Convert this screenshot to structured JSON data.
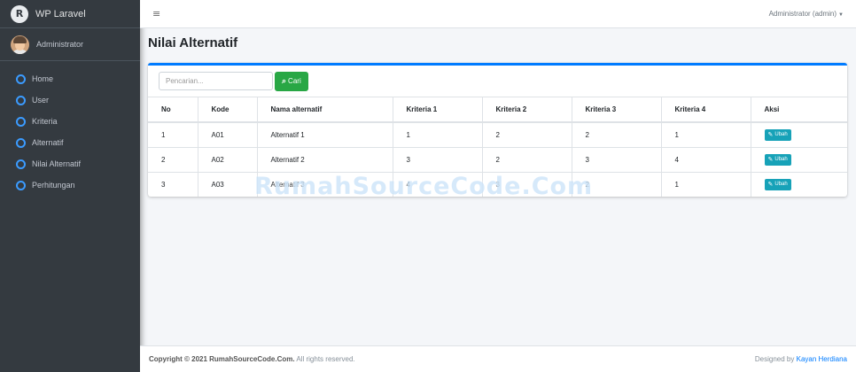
{
  "brand": {
    "logo_letter": "R",
    "name": "WP Laravel"
  },
  "user_panel": {
    "name": "Administrator"
  },
  "sidebar": {
    "items": [
      {
        "label": "Home"
      },
      {
        "label": "User"
      },
      {
        "label": "Kriteria"
      },
      {
        "label": "Alternatif"
      },
      {
        "label": "Nilai Alternatif"
      },
      {
        "label": "Perhitungan"
      }
    ]
  },
  "topbar": {
    "menu_icon": "≡",
    "user_menu": "Administrator (admin)",
    "caret": "▼"
  },
  "page": {
    "title": "Nilai Alternatif"
  },
  "search": {
    "placeholder": "Pencarian...",
    "button_label": "Cari",
    "button_icon": "search-icon"
  },
  "table": {
    "headers": [
      "No",
      "Kode",
      "Nama alternatif",
      "Kriteria 1",
      "Kriteria 2",
      "Kriteria 3",
      "Kriteria 4",
      "Aksi"
    ],
    "rows": [
      [
        "1",
        "A01",
        "Alternatif 1",
        "1",
        "2",
        "2",
        "1"
      ],
      [
        "2",
        "A02",
        "Alternatif 2",
        "3",
        "2",
        "3",
        "4"
      ],
      [
        "3",
        "A03",
        "Alternatif 3",
        "4",
        "3",
        "2",
        "1"
      ]
    ],
    "action_label": "Ubah"
  },
  "watermark": "RumahSourceCode.Com",
  "footer": {
    "copyright_bold": "Copyright © 2021 RumahSourceCode.Com.",
    "copyright_rest": "All rights reserved.",
    "designed_by_text": "Designed by",
    "designer": "Kayan Herdiana"
  },
  "colors": {
    "sidebar": "#343a40",
    "primary": "#007bff",
    "success": "#28a745",
    "info": "#17a2b8",
    "nav_icon": "#3b9bff"
  }
}
